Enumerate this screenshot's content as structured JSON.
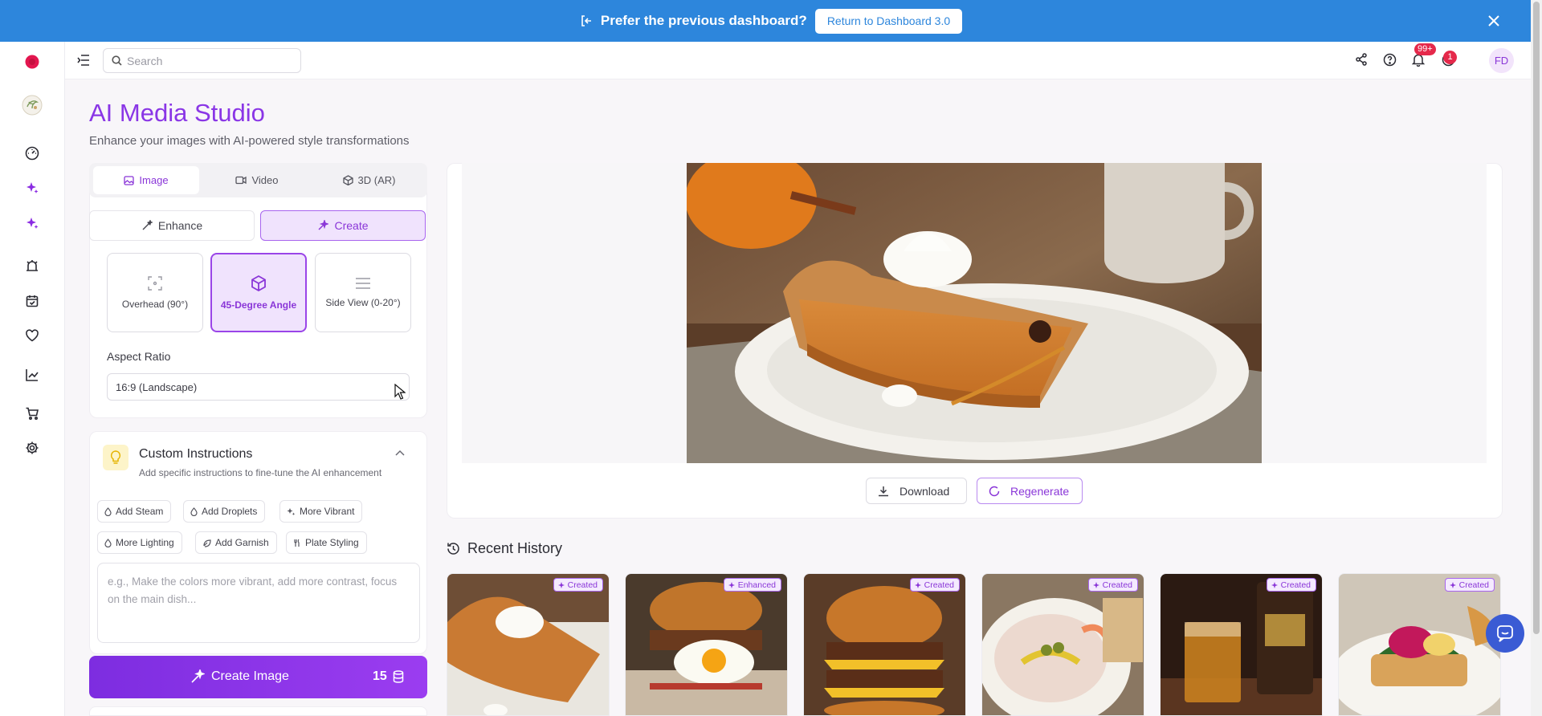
{
  "banner": {
    "message": "Prefer the previous dashboard?",
    "button_label": "Return to Dashboard 3.0",
    "color": "#2d86dc"
  },
  "search": {
    "placeholder": "Search"
  },
  "topbar": {
    "notification_badge": "99+",
    "alert_badge": "1",
    "avatar_initials": "FD"
  },
  "page": {
    "title": "AI Media Studio",
    "subtitle": "Enhance your images with AI-powered style transformations",
    "accent_color": "#8a36e6"
  },
  "media_tabs": [
    {
      "label": "Image",
      "icon": "image-icon",
      "active": true
    },
    {
      "label": "Video",
      "icon": "video-icon",
      "active": false
    },
    {
      "label": "3D (AR)",
      "icon": "cube-icon",
      "active": false
    }
  ],
  "mode": {
    "enhance_label": "Enhance",
    "create_label": "Create",
    "selected": "Create"
  },
  "angles": [
    {
      "label": "Overhead (90°)",
      "icon": "overhead-icon",
      "selected": false
    },
    {
      "label": "45-Degree Angle",
      "icon": "cube-icon",
      "selected": true
    },
    {
      "label": "Side View (0-20°)",
      "icon": "lines-icon",
      "selected": false
    }
  ],
  "aspect_ratio": {
    "label": "Aspect Ratio",
    "value": "16:9 (Landscape)"
  },
  "custom_instructions": {
    "title": "Custom Instructions",
    "subtitle": "Add specific instructions to fine-tune the AI enhancement",
    "chips": [
      "Add Steam",
      "Add Droplets",
      "More Vibrant",
      "More Lighting",
      "Add Garnish",
      "Plate Styling"
    ],
    "placeholder": "e.g., Make the colors more vibrant, add more contrast, focus on the main dish..."
  },
  "create_button": {
    "label": "Create Image",
    "credits": "15"
  },
  "preview": {
    "download_label": "Download",
    "regenerate_label": "Regenerate"
  },
  "history": {
    "title": "Recent History",
    "items": [
      {
        "tag": "Created",
        "subject": "pumpkin pie slice"
      },
      {
        "tag": "Enhanced",
        "subject": "burger with fried egg"
      },
      {
        "tag": "Created",
        "subject": "double cheeseburger"
      },
      {
        "tag": "Created",
        "subject": "hummus with shrimp"
      },
      {
        "tag": "Created",
        "subject": "whiskey glass"
      },
      {
        "tag": "Created",
        "subject": "eggs benedict"
      }
    ]
  }
}
